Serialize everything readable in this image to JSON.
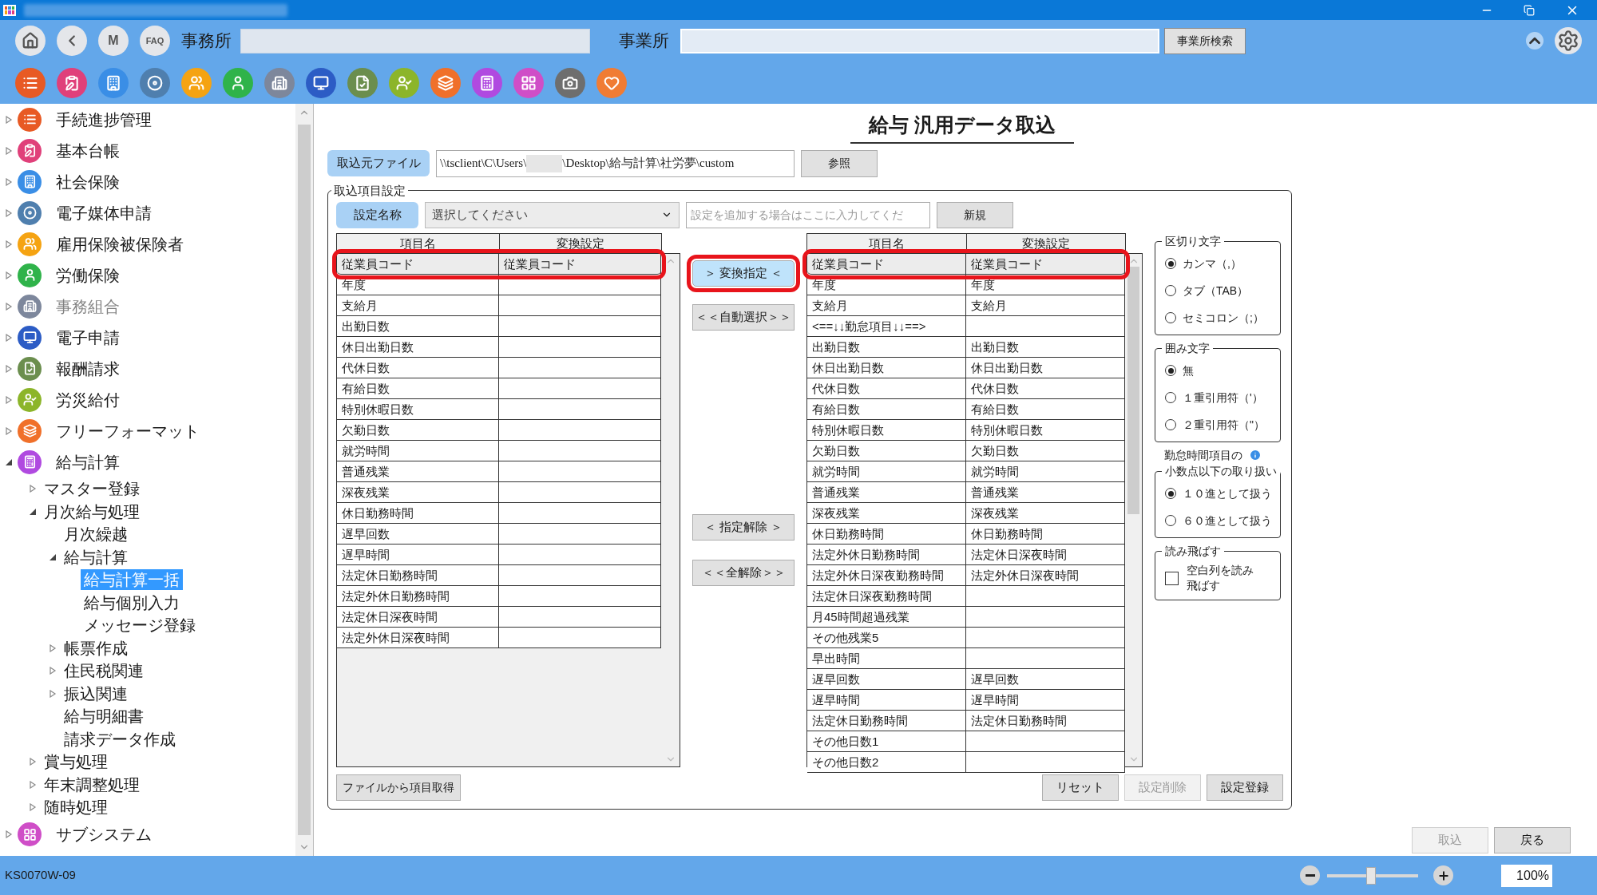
{
  "header": {
    "nav_buttons": [
      {
        "kind": "home"
      },
      {
        "kind": "back"
      },
      {
        "kind": "map",
        "label": "M"
      },
      {
        "kind": "faq",
        "label": "FAQ"
      }
    ],
    "office_label": "事務所",
    "site_label": "事業所",
    "site_search_button": "事業所検索",
    "app_icons": [
      {
        "color": "#e85a24"
      },
      {
        "color": "#e0407a"
      },
      {
        "color": "#3a8ee6"
      },
      {
        "color": "#4f7fae"
      },
      {
        "color": "#f5a312"
      },
      {
        "color": "#2fb34a"
      },
      {
        "color": "#7d879c"
      },
      {
        "color": "#2c5cc5"
      },
      {
        "color": "#6b8e4e"
      },
      {
        "color": "#8cb52a"
      },
      {
        "color": "#f0702a"
      },
      {
        "color": "#b04ae0"
      },
      {
        "color": "#cf4ec7"
      },
      {
        "color": "#6e6e6e"
      },
      {
        "color": "#f07c34"
      }
    ]
  },
  "sidebar": {
    "items": [
      {
        "label": "手続進捗管理",
        "color": "#e85a24",
        "expanded": false,
        "selected": false,
        "disabled": false
      },
      {
        "label": "基本台帳",
        "color": "#e0407a",
        "expanded": false,
        "selected": false,
        "disabled": false
      },
      {
        "label": "社会保険",
        "color": "#3a8ee6",
        "expanded": false,
        "selected": false,
        "disabled": false
      },
      {
        "label": "電子媒体申請",
        "color": "#4f7fae",
        "expanded": false,
        "selected": false,
        "disabled": false
      },
      {
        "label": "雇用保険被保険者",
        "color": "#f5a312",
        "expanded": false,
        "selected": false,
        "disabled": false
      },
      {
        "label": "労働保険",
        "color": "#2fb34a",
        "expanded": false,
        "selected": false,
        "disabled": false
      },
      {
        "label": "事務組合",
        "color": "#7d879c",
        "expanded": false,
        "selected": false,
        "disabled": true
      },
      {
        "label": "電子申請",
        "color": "#2c5cc5",
        "expanded": false,
        "selected": false,
        "disabled": false
      },
      {
        "label": "報酬請求",
        "color": "#6b8e4e",
        "expanded": false,
        "selected": false,
        "disabled": false
      },
      {
        "label": "労災給付",
        "color": "#8cb52a",
        "expanded": false,
        "selected": false,
        "disabled": false
      },
      {
        "label": "フリーフォーマット",
        "color": "#f0702a",
        "expanded": false,
        "selected": false,
        "disabled": false
      },
      {
        "label": "給与計算",
        "color": "#b04ae0",
        "expanded": true,
        "selected": false,
        "disabled": false,
        "children": [
          {
            "label": "マスター登録",
            "expanded": false,
            "selected": false,
            "disabled": false
          },
          {
            "label": "月次給与処理",
            "expanded": true,
            "selected": false,
            "disabled": false,
            "children": [
              {
                "label": "月次繰越",
                "selected": false,
                "disabled": false
              },
              {
                "label": "給与計算",
                "expanded": true,
                "selected": false,
                "disabled": false,
                "children": [
                  {
                    "label": "給与計算一括",
                    "selected": true,
                    "disabled": false
                  },
                  {
                    "label": "給与個別入力",
                    "selected": false,
                    "disabled": false
                  },
                  {
                    "label": "メッセージ登録",
                    "selected": false,
                    "disabled": false
                  }
                ]
              },
              {
                "label": "帳票作成",
                "expanded": false,
                "selected": false,
                "disabled": false
              },
              {
                "label": "住民税関連",
                "expanded": false,
                "selected": false,
                "disabled": false
              },
              {
                "label": "振込関連",
                "expanded": false,
                "selected": false,
                "disabled": false
              },
              {
                "label": "給与明細書",
                "selected": false,
                "disabled": false
              },
              {
                "label": "請求データ作成",
                "selected": false,
                "disabled": false
              }
            ]
          },
          {
            "label": "賞与処理",
            "expanded": false,
            "selected": false,
            "disabled": false
          },
          {
            "label": "年末調整処理",
            "expanded": false,
            "selected": false,
            "disabled": false
          },
          {
            "label": "随時処理",
            "expanded": false,
            "selected": false,
            "disabled": false
          }
        ]
      },
      {
        "label": "サブシステム",
        "color": "#cf4ec7",
        "expanded": false,
        "selected": false,
        "disabled": false
      }
    ]
  },
  "page": {
    "title": "給与 汎用データ取込",
    "source_file_button": "取込元ファイル",
    "path_prefix": "\\\\tsclient\\C\\Users\\",
    "path_suffix": "\\Desktop\\給与計算\\社労夢\\custom",
    "browse_button": "参照"
  },
  "import_settings": {
    "legend": "取込項目設定",
    "setting_name_button": "設定名称",
    "setting_select": "選択してください",
    "new_setting": {
      "placeholder": "設定を追加する場合はここに入力してくだ"
    },
    "new_button": "新規",
    "source_table": {
      "columns": [
        "項目名",
        "変換設定"
      ],
      "rows": [
        {
          "item": "従業員コード",
          "conversion": "従業員コード",
          "selected": true,
          "highlighted": true
        },
        {
          "item": "年度",
          "conversion": "",
          "selected": false,
          "highlighted": false
        },
        {
          "item": "支給月",
          "conversion": "",
          "selected": false,
          "highlighted": false
        },
        {
          "item": "出勤日数",
          "conversion": "",
          "selected": false,
          "highlighted": false
        },
        {
          "item": "休日出勤日数",
          "conversion": "",
          "selected": false,
          "highlighted": false
        },
        {
          "item": "代休日数",
          "conversion": "",
          "selected": false,
          "highlighted": false
        },
        {
          "item": "有給日数",
          "conversion": "",
          "selected": false,
          "highlighted": false
        },
        {
          "item": "特別休暇日数",
          "conversion": "",
          "selected": false,
          "highlighted": false
        },
        {
          "item": "欠勤日数",
          "conversion": "",
          "selected": false,
          "highlighted": false
        },
        {
          "item": "就労時間",
          "conversion": "",
          "selected": false,
          "highlighted": false
        },
        {
          "item": "普通残業",
          "conversion": "",
          "selected": false,
          "highlighted": false
        },
        {
          "item": "深夜残業",
          "conversion": "",
          "selected": false,
          "highlighted": false
        },
        {
          "item": "休日勤務時間",
          "conversion": "",
          "selected": false,
          "highlighted": false
        },
        {
          "item": "遅早回数",
          "conversion": "",
          "selected": false,
          "highlighted": false
        },
        {
          "item": "遅早時間",
          "conversion": "",
          "selected": false,
          "highlighted": false
        },
        {
          "item": "法定休日勤務時間",
          "conversion": "",
          "selected": false,
          "highlighted": false
        },
        {
          "item": "法定外休日勤務時間",
          "conversion": "",
          "selected": false,
          "highlighted": false
        },
        {
          "item": "法定休日深夜時間",
          "conversion": "",
          "selected": false,
          "highlighted": false
        },
        {
          "item": "法定外休日深夜時間",
          "conversion": "",
          "selected": false,
          "highlighted": false
        }
      ]
    },
    "transfer_buttons": [
      {
        "label": "＞ 変換指定 ＜",
        "primary": true,
        "highlighted": true
      },
      {
        "label": "＜＜自動選択＞＞",
        "primary": false,
        "highlighted": false
      },
      {
        "label": "＜ 指定解除 ＞",
        "primary": false,
        "highlighted": false
      },
      {
        "label": "＜＜全解除＞＞",
        "primary": false,
        "highlighted": false
      }
    ],
    "target_table": {
      "columns": [
        "項目名",
        "変換設定"
      ],
      "rows": [
        {
          "item": "従業員コード",
          "conversion": "従業員コード",
          "selected": true,
          "highlighted": true
        },
        {
          "item": "年度",
          "conversion": "年度",
          "selected": false,
          "highlighted": false
        },
        {
          "item": "支給月",
          "conversion": "支給月",
          "selected": false,
          "highlighted": false
        },
        {
          "item": "<==↓↓勤怠項目↓↓==>",
          "conversion": "",
          "selected": false,
          "highlighted": false
        },
        {
          "item": "出勤日数",
          "conversion": "出勤日数",
          "selected": false,
          "highlighted": false
        },
        {
          "item": "休日出勤日数",
          "conversion": "休日出勤日数",
          "selected": false,
          "highlighted": false
        },
        {
          "item": "代休日数",
          "conversion": "代休日数",
          "selected": false,
          "highlighted": false
        },
        {
          "item": "有給日数",
          "conversion": "有給日数",
          "selected": false,
          "highlighted": false
        },
        {
          "item": "特別休暇日数",
          "conversion": "特別休暇日数",
          "selected": false,
          "highlighted": false
        },
        {
          "item": "欠勤日数",
          "conversion": "欠勤日数",
          "selected": false,
          "highlighted": false
        },
        {
          "item": "就労時間",
          "conversion": "就労時間",
          "selected": false,
          "highlighted": false
        },
        {
          "item": "普通残業",
          "conversion": "普通残業",
          "selected": false,
          "highlighted": false
        },
        {
          "item": "深夜残業",
          "conversion": "深夜残業",
          "selected": false,
          "highlighted": false
        },
        {
          "item": "休日勤務時間",
          "conversion": "休日勤務時間",
          "selected": false,
          "highlighted": false
        },
        {
          "item": "法定外休日勤務時間",
          "conversion": "法定休日深夜時間",
          "selected": false,
          "highlighted": false
        },
        {
          "item": "法定外休日深夜勤務時間",
          "conversion": "法定外休日深夜時間",
          "selected": false,
          "highlighted": false
        },
        {
          "item": "法定休日深夜勤務時間",
          "conversion": "",
          "selected": false,
          "highlighted": false
        },
        {
          "item": "月45時間超過残業",
          "conversion": "",
          "selected": false,
          "highlighted": false
        },
        {
          "item": "その他残業5",
          "conversion": "",
          "selected": false,
          "highlighted": false
        },
        {
          "item": "早出時間",
          "conversion": "",
          "selected": false,
          "highlighted": false
        },
        {
          "item": "遅早回数",
          "conversion": "遅早回数",
          "selected": false,
          "highlighted": false
        },
        {
          "item": "遅早時間",
          "conversion": "遅早時間",
          "selected": false,
          "highlighted": false
        },
        {
          "item": "法定休日勤務時間",
          "conversion": "法定休日勤務時間",
          "selected": false,
          "highlighted": false
        },
        {
          "item": "その他日数1",
          "conversion": "",
          "selected": false,
          "highlighted": false
        },
        {
          "item": "その他日数2",
          "conversion": "",
          "selected": false,
          "highlighted": false
        }
      ]
    },
    "option_groups": [
      {
        "kind": "radio",
        "title": "区切り文字",
        "options": [
          {
            "label": "カンマ（,）",
            "selected": true
          },
          {
            "label": "タブ（TAB）",
            "selected": false
          },
          {
            "label": "セミコロン（;）",
            "selected": false
          }
        ]
      },
      {
        "kind": "radio",
        "title": "囲み文字",
        "options": [
          {
            "label": "無",
            "selected": true
          },
          {
            "label": "１重引用符（'）",
            "selected": false
          },
          {
            "label": "２重引用符（\"）",
            "selected": false
          }
        ]
      },
      {
        "kind": "radio",
        "title_above": "勤怠時間項目の",
        "title": "小数点以下の取り扱い",
        "options": [
          {
            "label": "１０進として扱う",
            "selected": true
          },
          {
            "label": "６０進として扱う",
            "selected": false
          }
        ]
      },
      {
        "kind": "checkbox",
        "title": "読み飛ばす",
        "options": [
          {
            "label": "空白列を読み飛ばす",
            "checked": false
          }
        ]
      }
    ],
    "fetch_button": "ファイルから項目取得",
    "footer_buttons": [
      {
        "label": "リセット",
        "disabled": false
      },
      {
        "label": "設定削除",
        "disabled": true
      },
      {
        "label": "設定登録",
        "disabled": false
      }
    ]
  },
  "actions": [
    {
      "label": "取込",
      "disabled": true
    },
    {
      "label": "戻る",
      "disabled": false
    }
  ],
  "status_bar": {
    "screen_id": "KS0070W-09",
    "zoom": {
      "level": 0.48,
      "value": "100%"
    }
  }
}
